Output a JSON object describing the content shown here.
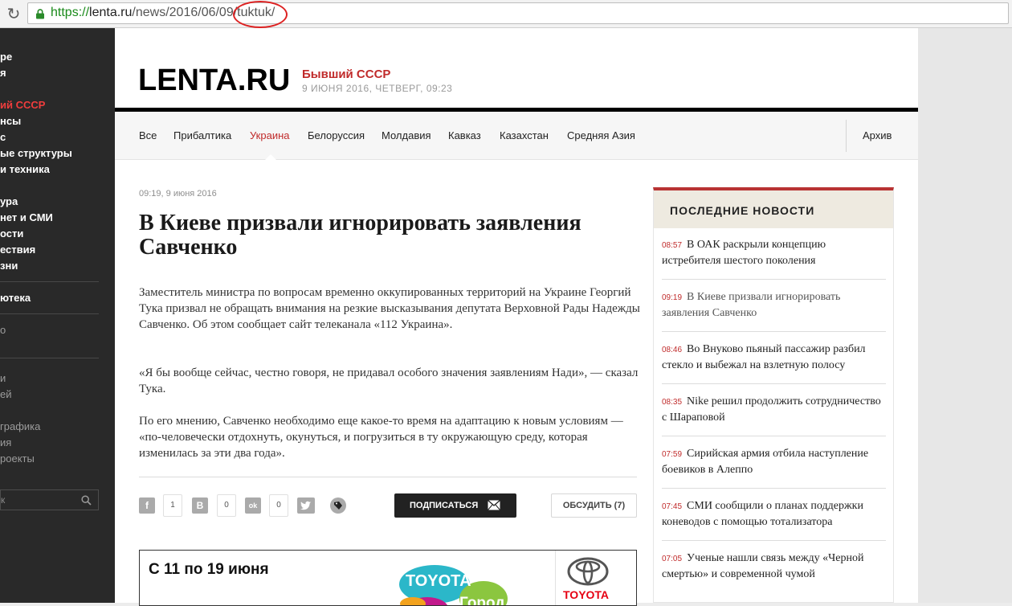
{
  "browser": {
    "url_scheme": "https://",
    "url_host": "lenta.ru",
    "url_path": "/news/2016/06/09/",
    "url_slug": "tuktuk/"
  },
  "sidebar": {
    "items": [
      {
        "label": "ре",
        "style": "bold"
      },
      {
        "label": "я",
        "style": "bold"
      },
      {
        "label": "ий СССР",
        "style": "active"
      },
      {
        "label": "нсы",
        "style": "bold"
      },
      {
        "label": "с",
        "style": "bold"
      },
      {
        "label": "ые структуры",
        "style": "bold"
      },
      {
        "label": "и техника",
        "style": "bold"
      },
      {
        "label": "ура",
        "style": "bold"
      },
      {
        "label": "нет и СМИ",
        "style": "bold"
      },
      {
        "label": "ости",
        "style": "bold"
      },
      {
        "label": "ествия",
        "style": "bold"
      },
      {
        "label": "зни",
        "style": "bold"
      },
      {
        "label": "ютека",
        "style": "bold"
      },
      {
        "label": "о",
        "style": "gray"
      },
      {
        "label": "",
        "style": "gray"
      },
      {
        "label": "и",
        "style": "gray"
      },
      {
        "label": "ей",
        "style": "gray"
      },
      {
        "label": "",
        "style": "gray"
      },
      {
        "label": "графика",
        "style": "gray"
      },
      {
        "label": "ия",
        "style": "gray"
      },
      {
        "label": "роекты",
        "style": "gray"
      }
    ],
    "search_placeholder": "к"
  },
  "header": {
    "logo": "LENTA.RU",
    "rubric": "Бывший СССР",
    "date": "9 ИЮНЯ 2016, ЧЕТВЕРГ, 09:23"
  },
  "nav": {
    "items": [
      "Все",
      "Прибалтика",
      "Украина",
      "Белоруссия",
      "Молдавия",
      "Кавказ",
      "Казахстан",
      "Средняя Азия"
    ],
    "active": "Украина",
    "archive": "Архив"
  },
  "article": {
    "meta": "09:19, 9 июня 2016",
    "title": "В Киеве призвали игнорировать заявления Савченко",
    "paragraphs": [
      "Заместитель министра по вопросам временно оккупированных территорий на Украине Георгий Тука призвал не обращать внимания на резкие высказывания депутата Верховной Рады Надежды Савченко. Об этом сообщает сайт телеканала «112 Украина».",
      "«Я бы вообще сейчас, честно говоря, не придавал особого значения заявлениям Нади», — сказал Тука.",
      "По его мнению, Савченко необходимо еще какое-то время на адаптацию к новым условиям — «по-человечески отдохнуть, окунуться, и погрузиться в ту окружающую среду, которая изменилась за эти два года»."
    ]
  },
  "share": {
    "facebook_icon": "f",
    "facebook_count": "1",
    "vk_icon": "B",
    "vk_count": "0",
    "ok_icon": "ok",
    "ok_count": "0",
    "subscribe_label": "ПОДПИСАТЬСЯ",
    "discuss_label": "ОБСУДИТЬ (7)"
  },
  "ad": {
    "text": "С 11 по 19 июня",
    "city_word1": "ТОYОТА",
    "city_word2": "Город",
    "brand": "TOYOTA"
  },
  "latest": {
    "title": "ПОСЛЕДНИЕ НОВОСТИ",
    "items": [
      {
        "time": "08:57",
        "text": "В ОАК раскрыли концепцию истребителя шестого поколения"
      },
      {
        "time": "09:19",
        "text": "В Киеве призвали игнорировать заявления Савченко"
      },
      {
        "time": "08:46",
        "text": "Во Внуково пьяный пассажир разбил стекло и выбежал на взлетную полосу"
      },
      {
        "time": "08:35",
        "text": "Nike решил продолжить сотрудничество с Шараповой"
      },
      {
        "time": "07:59",
        "text": "Сирийская армия отбила наступление боевиков в Алеппо"
      },
      {
        "time": "07:45",
        "text": "СМИ сообщили о планах поддержки коневодов с помощью тотализатора"
      },
      {
        "time": "07:05",
        "text": "Ученые нашли связь между «Черной смертью» и современной чумой"
      }
    ]
  },
  "colors": {
    "accent": "#c02b2b",
    "sidebar_bg": "#292929",
    "sidebar_active": "#ef3d3d"
  }
}
